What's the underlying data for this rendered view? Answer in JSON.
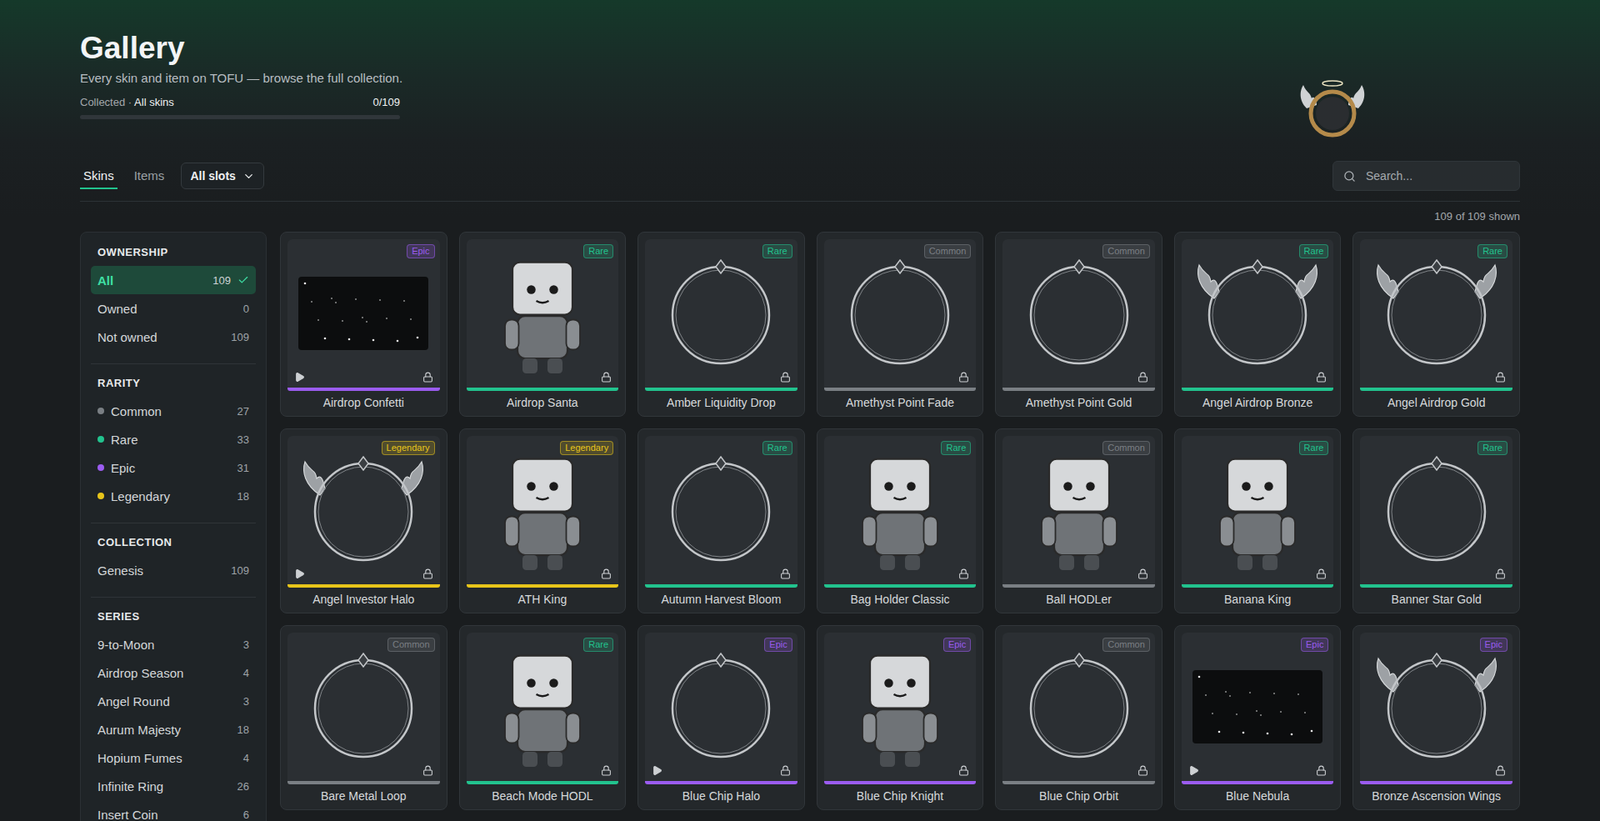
{
  "header": {
    "title": "Gallery",
    "subtitle": "Every skin and item on TOFU — browse the full collection.",
    "progress": {
      "label": "Collected",
      "separator": "·",
      "scope": "All skins",
      "count": "0/109",
      "level": 0
    }
  },
  "tabs": [
    {
      "label": "Skins",
      "selected": true
    },
    {
      "label": "Items",
      "selected": false
    }
  ],
  "slot_filter": {
    "value": "All slots"
  },
  "search": {
    "placeholder": "Search..."
  },
  "shown": "109 of 109 shown",
  "sidebar": {
    "sections": [
      {
        "title": "OWNERSHIP",
        "items": [
          {
            "label": "All",
            "count": "109",
            "selected": true
          },
          {
            "label": "Owned",
            "count": "0",
            "selected": false
          },
          {
            "label": "Not owned",
            "count": "109",
            "selected": false
          }
        ]
      },
      {
        "title": "RARITY",
        "items": [
          {
            "label": "Common",
            "count": "27",
            "selected": false,
            "color": "#7a7f84"
          },
          {
            "label": "Rare",
            "count": "33",
            "selected": false,
            "color": "#22c38e"
          },
          {
            "label": "Epic",
            "count": "31",
            "selected": false,
            "color": "#9b5cf0"
          },
          {
            "label": "Legendary",
            "count": "18",
            "selected": false,
            "color": "#e8c51a"
          }
        ]
      },
      {
        "title": "COLLECTION",
        "items": [
          {
            "label": "Genesis",
            "count": "109",
            "selected": false
          }
        ]
      },
      {
        "title": "SERIES",
        "items": [
          {
            "label": "9-to-Moon",
            "count": "3",
            "selected": false
          },
          {
            "label": "Airdrop Season",
            "count": "4",
            "selected": false
          },
          {
            "label": "Angel Round",
            "count": "3",
            "selected": false
          },
          {
            "label": "Aurum Majesty",
            "count": "18",
            "selected": false
          },
          {
            "label": "Hopium Fumes",
            "count": "4",
            "selected": false
          },
          {
            "label": "Infinite Ring",
            "count": "26",
            "selected": false
          },
          {
            "label": "Insert Coin",
            "count": "6",
            "selected": false
          }
        ]
      }
    ]
  },
  "cards": [
    {
      "name": "Airdrop Confetti",
      "rarity": "Epic",
      "color": "#9b5cf0",
      "kind": "scene",
      "animated": true,
      "locked": true
    },
    {
      "name": "Airdrop Santa",
      "rarity": "Rare",
      "color": "#22c38e",
      "kind": "character",
      "animated": false,
      "locked": true
    },
    {
      "name": "Amber Liquidity Drop",
      "rarity": "Rare",
      "color": "#22c38e",
      "kind": "frame",
      "animated": false,
      "locked": true
    },
    {
      "name": "Amethyst Point Fade",
      "rarity": "Common",
      "color": "#7a7f84",
      "kind": "frame",
      "animated": false,
      "locked": true
    },
    {
      "name": "Amethyst Point Gold",
      "rarity": "Common",
      "color": "#7a7f84",
      "kind": "frame",
      "animated": false,
      "locked": true
    },
    {
      "name": "Angel Airdrop Bronze",
      "rarity": "Rare",
      "color": "#22c38e",
      "kind": "winged",
      "animated": false,
      "locked": true
    },
    {
      "name": "Angel Airdrop Gold",
      "rarity": "Rare",
      "color": "#22c38e",
      "kind": "winged",
      "animated": false,
      "locked": true
    },
    {
      "name": "Angel Investor Halo",
      "rarity": "Legendary",
      "color": "#e8c51a",
      "kind": "winged",
      "animated": true,
      "locked": true
    },
    {
      "name": "ATH King",
      "rarity": "Legendary",
      "color": "#e8c51a",
      "kind": "character",
      "animated": false,
      "locked": true
    },
    {
      "name": "Autumn Harvest Bloom",
      "rarity": "Rare",
      "color": "#22c38e",
      "kind": "frame",
      "animated": false,
      "locked": true
    },
    {
      "name": "Bag Holder Classic",
      "rarity": "Rare",
      "color": "#22c38e",
      "kind": "character",
      "animated": false,
      "locked": true
    },
    {
      "name": "Ball HODLer",
      "rarity": "Common",
      "color": "#7a7f84",
      "kind": "character",
      "animated": false,
      "locked": true
    },
    {
      "name": "Banana King",
      "rarity": "Rare",
      "color": "#22c38e",
      "kind": "character",
      "animated": false,
      "locked": true
    },
    {
      "name": "Banner Star Gold",
      "rarity": "Rare",
      "color": "#22c38e",
      "kind": "frame",
      "animated": false,
      "locked": true
    },
    {
      "name": "Bare Metal Loop",
      "rarity": "Common",
      "color": "#7a7f84",
      "kind": "frame",
      "animated": false,
      "locked": true
    },
    {
      "name": "Beach Mode HODL",
      "rarity": "Rare",
      "color": "#22c38e",
      "kind": "character",
      "animated": false,
      "locked": true
    },
    {
      "name": "Blue Chip Halo",
      "rarity": "Epic",
      "color": "#9b5cf0",
      "kind": "frame",
      "animated": true,
      "locked": true
    },
    {
      "name": "Blue Chip Knight",
      "rarity": "Epic",
      "color": "#9b5cf0",
      "kind": "character",
      "animated": false,
      "locked": true
    },
    {
      "name": "Blue Chip Orbit",
      "rarity": "Common",
      "color": "#7a7f84",
      "kind": "frame",
      "animated": false,
      "locked": true
    },
    {
      "name": "Blue Nebula",
      "rarity": "Epic",
      "color": "#9b5cf0",
      "kind": "scene",
      "animated": true,
      "locked": true
    },
    {
      "name": "Bronze Ascension Wings",
      "rarity": "Epic",
      "color": "#9b5cf0",
      "kind": "winged",
      "animated": false,
      "locked": true
    }
  ]
}
